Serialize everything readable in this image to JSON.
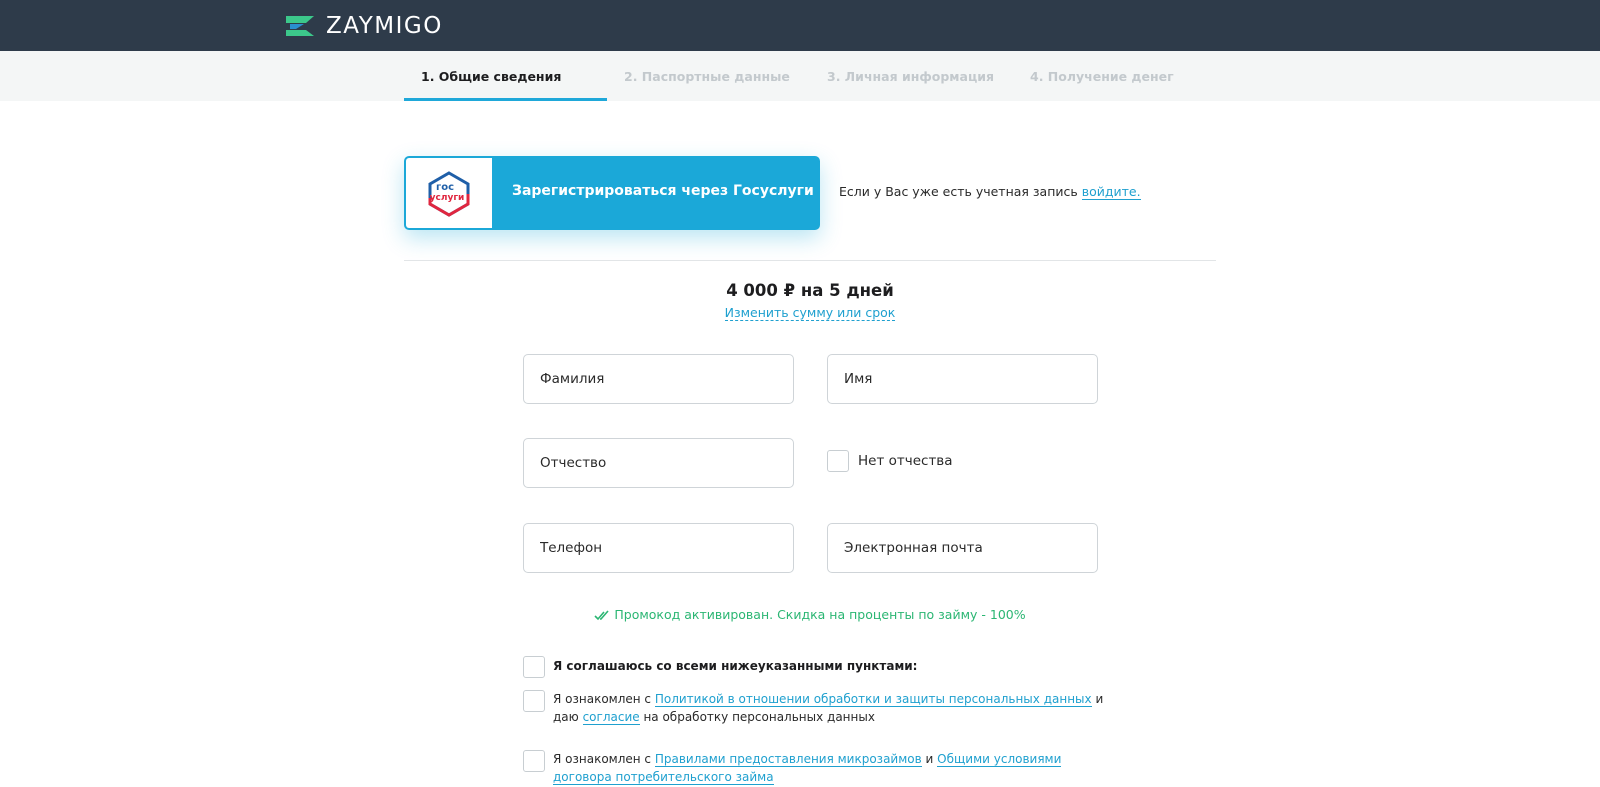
{
  "header": {
    "logo_text": "ZAYMIGO"
  },
  "steps": [
    {
      "label": "1. Общие сведения",
      "active": true
    },
    {
      "label": "2. Паспортные данные",
      "active": false
    },
    {
      "label": "3. Личная информация",
      "active": false
    },
    {
      "label": "4. Получение денег",
      "active": false
    }
  ],
  "gosuslugi": {
    "logo_line1": "гос",
    "logo_line2": "услуги",
    "button_label": "Зарегистрироваться через Госуслуги"
  },
  "login": {
    "text": "Если у Вас уже есть учетная запись ",
    "link": "войдите."
  },
  "loan": {
    "summary": "4 000 ₽ на 5 дней",
    "change_link": "Изменить сумму или срок"
  },
  "form": {
    "last_name_placeholder": "Фамилия",
    "first_name_placeholder": "Имя",
    "middle_name_placeholder": "Отчество",
    "no_middle_name_label": "Нет отчества",
    "phone_placeholder": "Телефон",
    "email_placeholder": "Электронная почта"
  },
  "promo": {
    "text": "Промокод активирован. Скидка на проценты по займу - 100%"
  },
  "agreements": {
    "all": "Я соглашаюсь со всеми нижеуказанными пунктами:",
    "privacy_pre": "Я ознакомлен с ",
    "privacy_link": "Политикой в отношении обработки и защиты персональных данных",
    "privacy_mid": " и даю ",
    "privacy_link2": "согласие",
    "privacy_post": " на обработку персональных данных",
    "rules_pre": "Я ознакомлен с ",
    "rules_link": "Правилами предоставления микрозаймов",
    "rules_mid": " и ",
    "rules_link2": "Общими условиями договора потребительского займа"
  },
  "colors": {
    "header_bg": "#2e3b4a",
    "accent": "#1ba8d8",
    "success": "#2bb673"
  }
}
